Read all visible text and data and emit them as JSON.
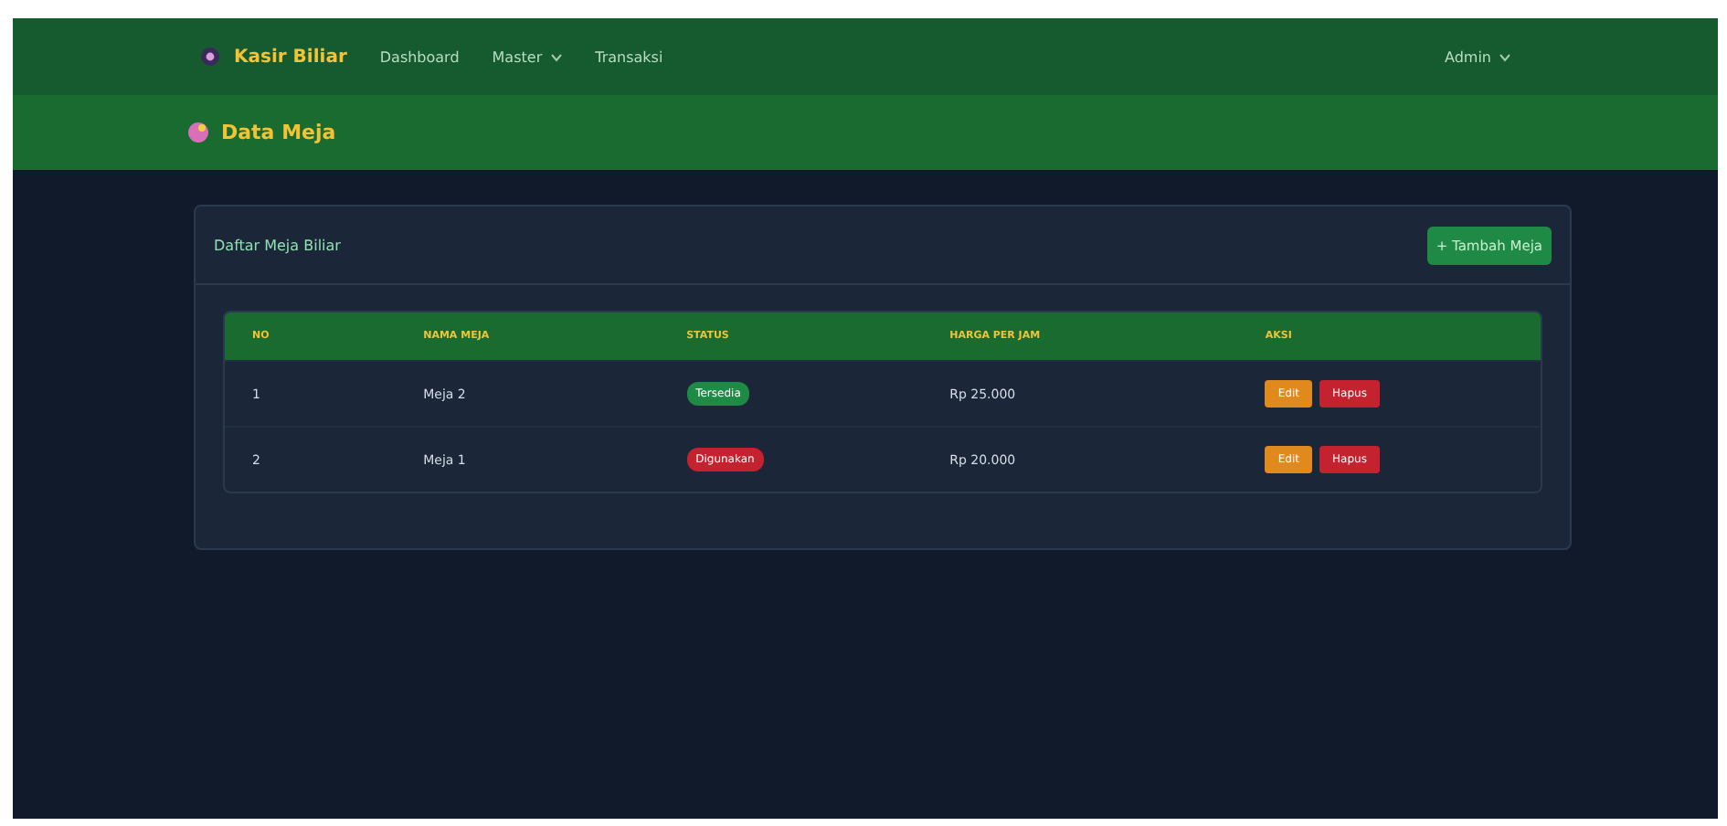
{
  "navbar": {
    "brand": "Kasir Biliar",
    "links": [
      {
        "label": "Dashboard",
        "dropdown": false
      },
      {
        "label": "Master",
        "dropdown": true
      },
      {
        "label": "Transaksi",
        "dropdown": false
      }
    ],
    "user": {
      "label": "Admin",
      "dropdown": true
    }
  },
  "page_title": "Data Meja",
  "card": {
    "title": "Daftar Meja Biliar",
    "add_button": "+ Tambah Meja",
    "table": {
      "columns": [
        "NO",
        "NAMA MEJA",
        "STATUS",
        "HARGA PER JAM",
        "AKSI"
      ],
      "rows": [
        {
          "no": "1",
          "name": "Meja 2",
          "status": {
            "label": "Tersedia",
            "color": "#1e8a45"
          },
          "price": "Rp 25.000",
          "actions": [
            "Edit",
            "Hapus"
          ]
        },
        {
          "no": "2",
          "name": "Meja 1",
          "status": {
            "label": "Digunakan",
            "color": "#c5222f"
          },
          "price": "Rp 20.000",
          "actions": [
            "Edit",
            "Hapus"
          ]
        }
      ]
    }
  }
}
